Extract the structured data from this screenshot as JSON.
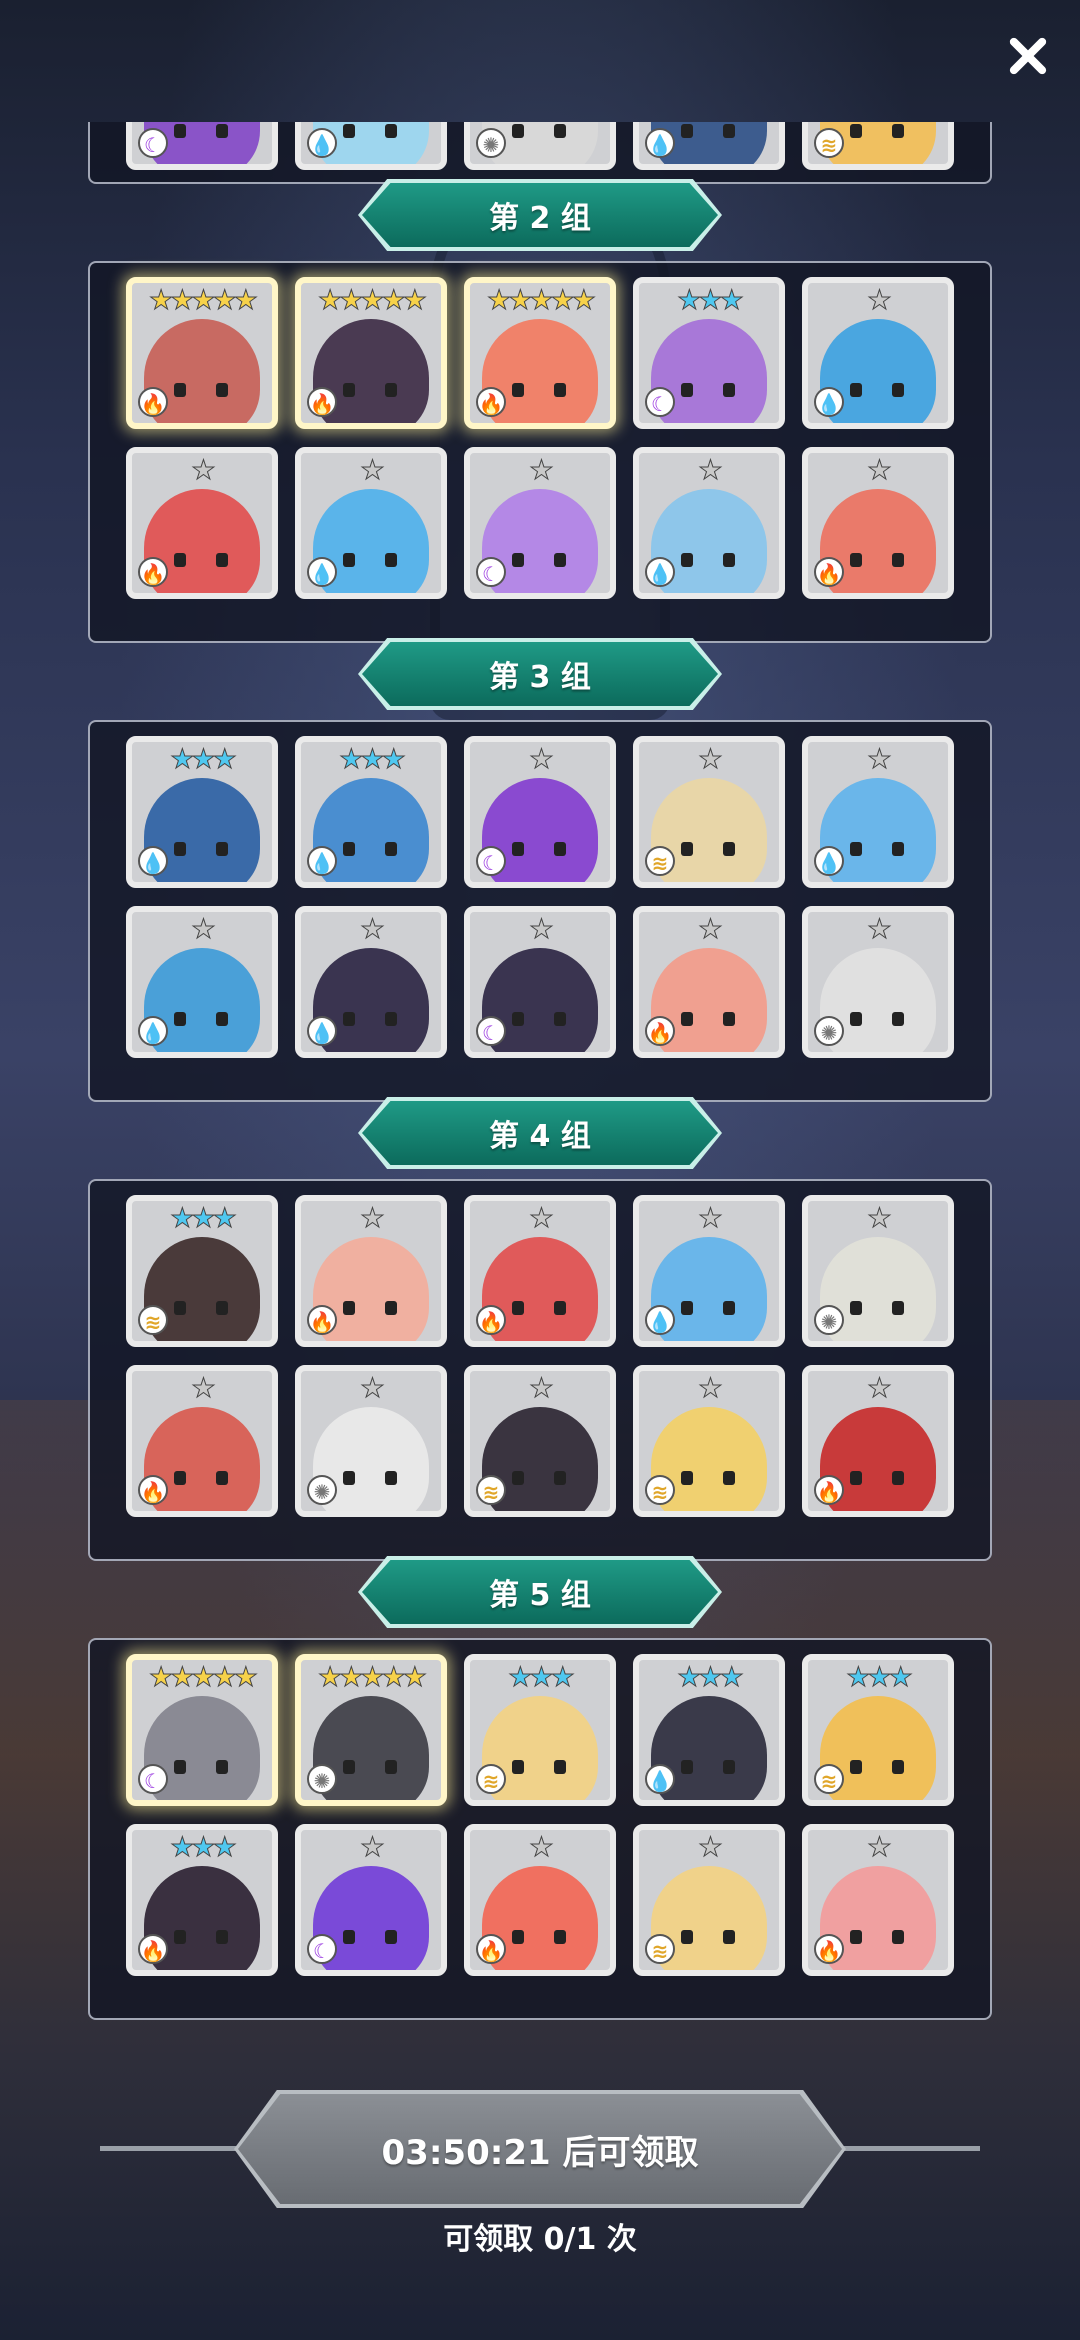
{
  "groups": [
    {
      "label": "第 2 组",
      "heroes": [
        {
          "stars": "",
          "rarity": "r1",
          "element": "dark",
          "elem_glyph": "☾",
          "color": "#8a54c8"
        },
        {
          "stars": "",
          "rarity": "r1",
          "element": "water",
          "elem_glyph": "💧",
          "color": "#9ed6ee"
        },
        {
          "stars": "",
          "rarity": "r1",
          "element": "light",
          "elem_glyph": "✺",
          "color": "#d8d8d8"
        },
        {
          "stars": "",
          "rarity": "r1",
          "element": "water",
          "elem_glyph": "💧",
          "color": "#3d5c8e"
        },
        {
          "stars": "",
          "rarity": "r1",
          "element": "wind",
          "elem_glyph": "≋",
          "color": "#f0c060"
        }
      ]
    },
    {
      "label": "第 3 组",
      "heroes": [
        {
          "stars": "★★★★★",
          "rarity": "r5",
          "element": "fire",
          "elem_glyph": "🔥",
          "color": "#c86a62"
        },
        {
          "stars": "★★★★★",
          "rarity": "r5",
          "element": "fire",
          "elem_glyph": "🔥",
          "color": "#4a3a52"
        },
        {
          "stars": "★★★★★",
          "rarity": "r5",
          "element": "fire",
          "elem_glyph": "🔥",
          "color": "#f0826a"
        },
        {
          "stars": "★★★",
          "rarity": "r3",
          "element": "dark",
          "elem_glyph": "☾",
          "color": "#a878d8"
        },
        {
          "stars": "★",
          "rarity": "r1",
          "element": "water",
          "elem_glyph": "💧",
          "color": "#4aa6e0"
        },
        {
          "stars": "★",
          "rarity": "r1",
          "element": "fire",
          "elem_glyph": "🔥",
          "color": "#e05a5a"
        },
        {
          "stars": "★",
          "rarity": "r1",
          "element": "water",
          "elem_glyph": "💧",
          "color": "#5ab4ea"
        },
        {
          "stars": "★",
          "rarity": "r1",
          "element": "dark",
          "elem_glyph": "☾",
          "color": "#b488e6"
        },
        {
          "stars": "★",
          "rarity": "r1",
          "element": "water",
          "elem_glyph": "💧",
          "color": "#8ec6ea"
        },
        {
          "stars": "★",
          "rarity": "r1",
          "element": "fire",
          "elem_glyph": "🔥",
          "color": "#ea7a6a"
        }
      ]
    },
    {
      "label": "第 4 组",
      "heroes": [
        {
          "stars": "★★★",
          "rarity": "r3",
          "element": "water",
          "elem_glyph": "💧",
          "color": "#3a6aa8"
        },
        {
          "stars": "★★★",
          "rarity": "r3",
          "element": "water",
          "elem_glyph": "💧",
          "color": "#4a8ed0"
        },
        {
          "stars": "★",
          "rarity": "r1",
          "element": "dark",
          "elem_glyph": "☾",
          "color": "#8a4ad0"
        },
        {
          "stars": "★",
          "rarity": "r1",
          "element": "wind",
          "elem_glyph": "≋",
          "color": "#e8d6a8"
        },
        {
          "stars": "★",
          "rarity": "r1",
          "element": "water",
          "elem_glyph": "💧",
          "color": "#6ab6ea"
        },
        {
          "stars": "★",
          "rarity": "r1",
          "element": "water",
          "elem_glyph": "💧",
          "color": "#4aa0d8"
        },
        {
          "stars": "★",
          "rarity": "r1",
          "element": "water",
          "elem_glyph": "💧",
          "color": "#3a3450"
        },
        {
          "stars": "★",
          "rarity": "r1",
          "element": "dark",
          "elem_glyph": "☾",
          "color": "#3a3450"
        },
        {
          "stars": "★",
          "rarity": "r1",
          "element": "fire",
          "elem_glyph": "🔥",
          "color": "#f0a090"
        },
        {
          "stars": "★",
          "rarity": "r1",
          "element": "light",
          "elem_glyph": "✺",
          "color": "#e0e0e0"
        }
      ]
    },
    {
      "label": "第 5 组",
      "heroes": [
        {
          "stars": "★★★",
          "rarity": "r3",
          "element": "wind",
          "elem_glyph": "≋",
          "color": "#4a3a3a"
        },
        {
          "stars": "★",
          "rarity": "r1",
          "element": "fire",
          "elem_glyph": "🔥",
          "color": "#f0b0a0"
        },
        {
          "stars": "★",
          "rarity": "r1",
          "element": "fire",
          "elem_glyph": "🔥",
          "color": "#e05a5a"
        },
        {
          "stars": "★",
          "rarity": "r1",
          "element": "water",
          "elem_glyph": "💧",
          "color": "#6ab6ea"
        },
        {
          "stars": "★",
          "rarity": "r1",
          "element": "light",
          "elem_glyph": "✺",
          "color": "#e0e0d8"
        },
        {
          "stars": "★",
          "rarity": "r1",
          "element": "fire",
          "elem_glyph": "🔥",
          "color": "#d8645a"
        },
        {
          "stars": "★",
          "rarity": "r1",
          "element": "light",
          "elem_glyph": "✺",
          "color": "#e8e8e8"
        },
        {
          "stars": "★",
          "rarity": "r1",
          "element": "wind",
          "elem_glyph": "≋",
          "color": "#3a3440"
        },
        {
          "stars": "★",
          "rarity": "r1",
          "element": "wind",
          "elem_glyph": "≋",
          "color": "#f0d070"
        },
        {
          "stars": "★",
          "rarity": "r1",
          "element": "fire",
          "elem_glyph": "🔥",
          "color": "#c83a3a"
        }
      ]
    },
    {
      "label": "",
      "heroes": [
        {
          "stars": "★★★★★",
          "rarity": "r5",
          "element": "dark",
          "elem_glyph": "☾",
          "color": "#8a8a94"
        },
        {
          "stars": "★★★★★",
          "rarity": "r5",
          "element": "light",
          "elem_glyph": "✺",
          "color": "#4a4a52"
        },
        {
          "stars": "★★★",
          "rarity": "r3",
          "element": "wind",
          "elem_glyph": "≋",
          "color": "#f0d28a"
        },
        {
          "stars": "★★★",
          "rarity": "r3",
          "element": "water",
          "elem_glyph": "💧",
          "color": "#3a3a4a"
        },
        {
          "stars": "★★★",
          "rarity": "r3",
          "element": "wind",
          "elem_glyph": "≋",
          "color": "#f0c05a"
        },
        {
          "stars": "★★★",
          "rarity": "r3",
          "element": "fire",
          "elem_glyph": "🔥",
          "color": "#3a3040"
        },
        {
          "stars": "★",
          "rarity": "r1",
          "element": "dark",
          "elem_glyph": "☾",
          "color": "#7a4ad8"
        },
        {
          "stars": "★",
          "rarity": "r1",
          "element": "fire",
          "elem_glyph": "🔥",
          "color": "#f07060"
        },
        {
          "stars": "★",
          "rarity": "r1",
          "element": "wind",
          "elem_glyph": "≋",
          "color": "#f0d28a"
        },
        {
          "stars": "★",
          "rarity": "r1",
          "element": "fire",
          "elem_glyph": "🔥",
          "color": "#f0a0a0"
        }
      ]
    }
  ],
  "footer": {
    "claim_button_label": "03:50:21 后可领取",
    "claim_count_label": "可领取 0/1 次"
  },
  "close_icon": "close-icon"
}
